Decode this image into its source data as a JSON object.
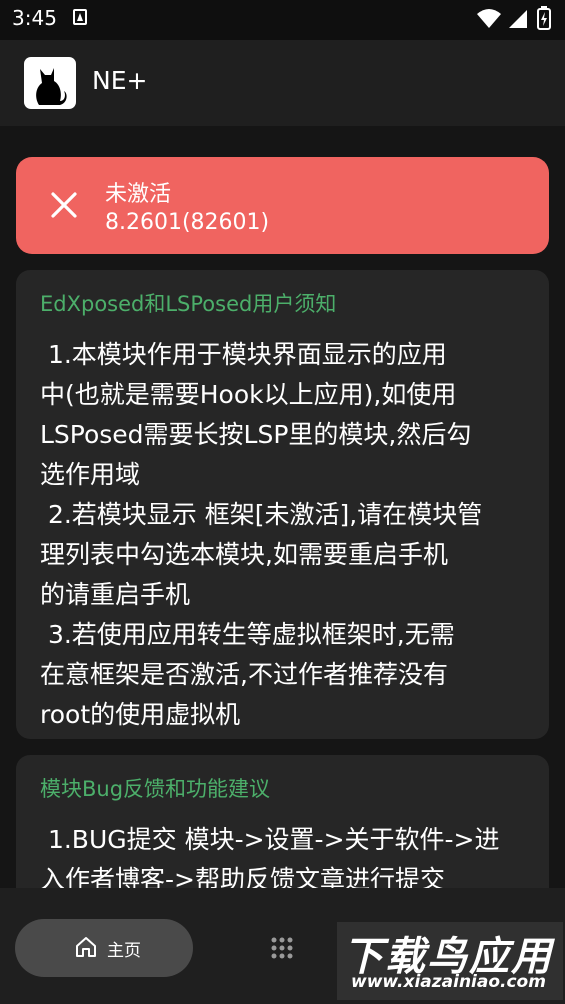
{
  "status_bar": {
    "time": "3:45",
    "icons": [
      "notification-a-icon",
      "wifi-icon",
      "signal-icon",
      "battery-icon"
    ]
  },
  "app_bar": {
    "title": "NE+",
    "logo_icon": "cat-icon"
  },
  "module_status": {
    "title": "未激活",
    "version": "8.2601(82601)",
    "icon": "close-icon",
    "color": "#f06460"
  },
  "cards": [
    {
      "heading": "EdXposed和LSPosed用户须知",
      "body": " 1.本模块作用于模块界面显示的应用\n中(也就是需要Hook以上应用),如使用\nLSPosed需要长按LSP里的模块,然后勾\n选作用域\n 2.若模块显示 框架[未激活],请在模块管\n理列表中勾选本模块,如需要重启手机\n的请重启手机\n 3.若使用应用转生等虚拟框架时,无需\n在意框架是否激活,不过作者推荐没有\nroot的使用虚拟机"
    },
    {
      "heading": "模块Bug反馈和功能建议",
      "body": " 1.BUG提交 模块->设置->关于软件->进\n入作者博客->帮助反馈文章进行提交"
    }
  ],
  "bottom_nav": {
    "home_label": "主页",
    "home_icon": "home-icon",
    "more_icon": "grid-icon"
  },
  "watermark": {
    "title": "下载鸟应用",
    "url": "www.xiazainiao.com"
  },
  "colors": {
    "accent_green": "#4caf6a",
    "error_red": "#f06460",
    "background": "#151515",
    "card": "#262626"
  }
}
